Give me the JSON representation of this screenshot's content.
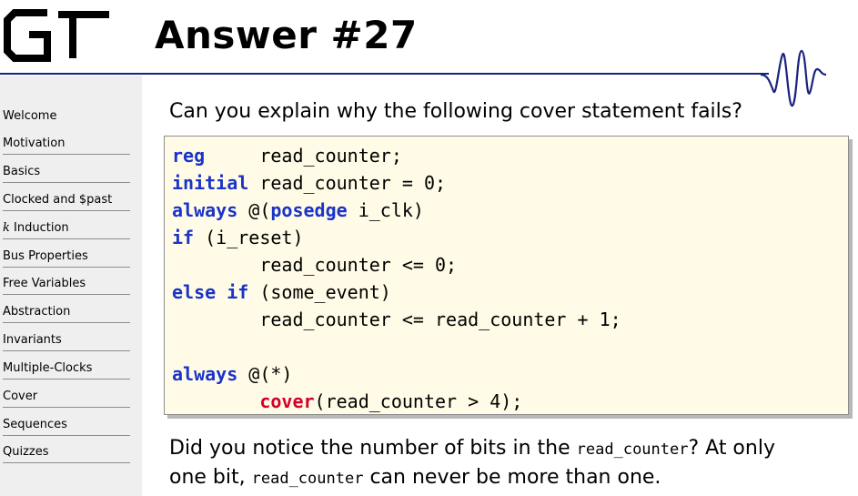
{
  "header": {
    "logo_text": "GT",
    "title": "Answer #27"
  },
  "sidebar": {
    "items": [
      {
        "label": "Welcome"
      },
      {
        "label": "Motivation"
      },
      {
        "label": "Basics"
      },
      {
        "label": "Clocked and $past"
      },
      {
        "k": "k",
        "label": " Induction"
      },
      {
        "label": "Bus Properties"
      },
      {
        "label": "Free Variables"
      },
      {
        "label": "Abstraction"
      },
      {
        "label": "Invariants"
      },
      {
        "label": "Multiple-Clocks"
      },
      {
        "label": "Cover"
      },
      {
        "label": "Sequences"
      },
      {
        "label": "Quizzes"
      }
    ]
  },
  "main": {
    "question": "Can you explain why the following cover statement fails?",
    "code": {
      "l1_kw": "reg",
      "l1_rest": "     read_counter;",
      "l2_kw": "initial",
      "l2_rest": " read_counter = 0;",
      "l3_kw": "always",
      "l3_a": " @(",
      "l3_kw2": "posedge",
      "l3_b": " i_clk)",
      "l4_kw": "if",
      "l4_rest": " (i_reset)",
      "l5": "        read_counter <= 0;",
      "l6_kw": "else if",
      "l6_rest": " (some_event)",
      "l7": "        read_counter <= read_counter + 1;",
      "l9_kw": "always",
      "l9_rest": " @(*)",
      "l10_indent": "        ",
      "l10_fn": "cover",
      "l10_rest": "(read_counter > 4);"
    },
    "answer": {
      "p1": "Did you notice the number of bits in the ",
      "code1": "read_counter",
      "p2": "? At only",
      "p3": "one bit, ",
      "code2": "read_counter",
      "p4": " can never be more than one."
    }
  },
  "colors": {
    "keyword": "#1a33c8",
    "cover": "#d6002a",
    "rule": "#1a237e",
    "code_bg": "#fffbe6",
    "sidebar_bg": "#efefef"
  }
}
